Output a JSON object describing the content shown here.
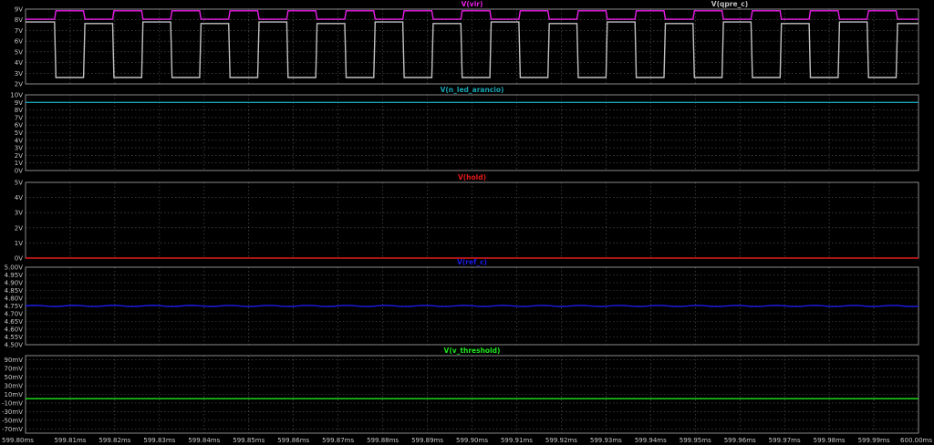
{
  "theme": {
    "background": "#000000",
    "frame": "#8a8a8a",
    "grid": "#5a5a5a",
    "tick_text": "#c8c8c8"
  },
  "x_axis": {
    "min": 599.8,
    "max": 600.0,
    "tick_labels": [
      "599.80ms",
      "599.81ms",
      "599.82ms",
      "599.83ms",
      "599.84ms",
      "599.85ms",
      "599.86ms",
      "599.87ms",
      "599.88ms",
      "599.89ms",
      "599.90ms",
      "599.91ms",
      "599.92ms",
      "599.93ms",
      "599.94ms",
      "599.95ms",
      "599.96ms",
      "599.97ms",
      "599.98ms",
      "599.99ms",
      "600.00ms"
    ]
  },
  "chart_data": [
    {
      "type": "line",
      "ylim": [
        2,
        9
      ],
      "y_ticks": [
        2,
        3,
        4,
        5,
        6,
        7,
        8,
        9
      ],
      "y_tick_labels": [
        "2V",
        "3V",
        "4V",
        "5V",
        "6V",
        "7V",
        "8V",
        "9V"
      ],
      "traces": [
        {
          "name": "V(vir)",
          "color": "#e81ee8",
          "label_align": "center",
          "kind": "pulse",
          "low": 8.05,
          "high": 8.85,
          "period_ms": 0.013,
          "first_rise_ms": 599.8065,
          "high_duration_ms": 0.0065
        },
        {
          "name": "V(qpre_c)",
          "color": "#c0c0c0",
          "label_align": "right",
          "kind": "pulse",
          "low": 2.6,
          "high": 7.8,
          "high_alt": 7.65,
          "period_ms": 0.013,
          "first_rise_ms": 599.813,
          "high_duration_ms": 0.0065
        }
      ]
    },
    {
      "type": "line",
      "ylim": [
        0,
        10
      ],
      "y_ticks": [
        0,
        1,
        2,
        3,
        4,
        5,
        6,
        7,
        8,
        9,
        10
      ],
      "y_tick_labels": [
        "0V",
        "1V",
        "2V",
        "3V",
        "4V",
        "5V",
        "6V",
        "7V",
        "8V",
        "9V",
        "10V"
      ],
      "traces": [
        {
          "name": "V(n_led_arancio)",
          "color": "#16a3b3",
          "label_align": "center",
          "kind": "flat",
          "value": 9.0
        }
      ]
    },
    {
      "type": "line",
      "ylim": [
        0,
        5
      ],
      "y_ticks": [
        0,
        1,
        2,
        3,
        4,
        5
      ],
      "y_tick_labels": [
        "0V",
        "1V",
        "2V",
        "3V",
        "4V",
        "5V"
      ],
      "traces": [
        {
          "name": "V(hold)",
          "color": "#e11b1b",
          "label_align": "center",
          "kind": "flat",
          "value": 0.0
        }
      ]
    },
    {
      "type": "line",
      "ylim": [
        4.5,
        5.0
      ],
      "y_ticks": [
        4.5,
        4.55,
        4.6,
        4.65,
        4.7,
        4.75,
        4.8,
        4.85,
        4.9,
        4.95,
        5.0
      ],
      "y_tick_labels": [
        "4.50V",
        "4.55V",
        "4.60V",
        "4.65V",
        "4.70V",
        "4.75V",
        "4.80V",
        "4.85V",
        "4.90V",
        "4.95V",
        "5.00V"
      ],
      "traces": [
        {
          "name": "V(ref_c)",
          "color": "#1a1ae8",
          "label_align": "center",
          "kind": "flat",
          "value": 4.75,
          "ripple": 0.004
        }
      ]
    },
    {
      "type": "line",
      "ylim": [
        -0.08,
        0.1
      ],
      "y_ticks": [
        -0.07,
        -0.05,
        -0.03,
        -0.01,
        0.01,
        0.03,
        0.05,
        0.07,
        0.09
      ],
      "y_tick_labels": [
        "-70mV",
        "-50mV",
        "-30mV",
        "-10mV",
        "10mV",
        "30mV",
        "50mV",
        "70mV",
        "90mV"
      ],
      "traces": [
        {
          "name": "V(v_threshold)",
          "color": "#1ee81e",
          "label_align": "center",
          "kind": "flat",
          "value": 0.0
        }
      ]
    }
  ]
}
